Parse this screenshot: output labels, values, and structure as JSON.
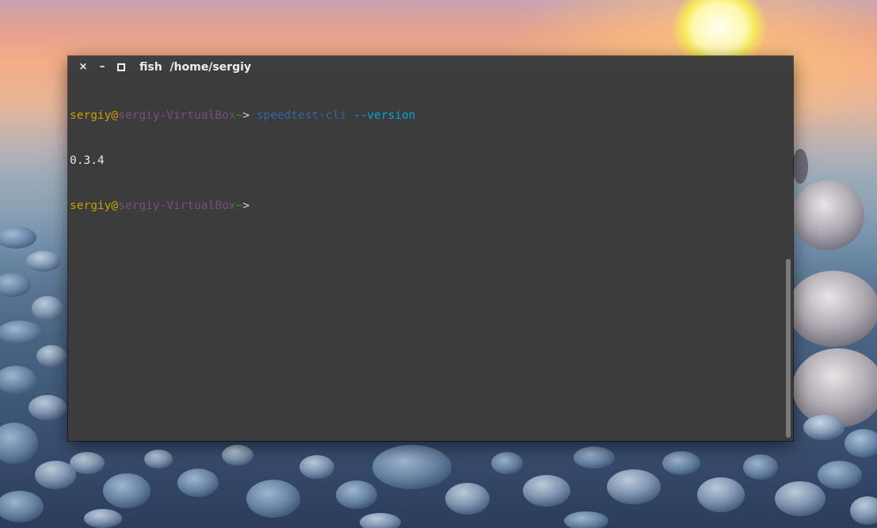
{
  "window": {
    "app": "fish",
    "path": "/home/sergiy",
    "buttons": {
      "close": "×",
      "minimize": "–"
    }
  },
  "terminal": {
    "lines": [
      {
        "user": "sergiy",
        "at": "@",
        "host": "sergiy-VirtualBox",
        "cwd": "~",
        "prompt": "> ",
        "command": "speedtest-cli",
        "args": " --version"
      },
      {
        "output": "0.3.4"
      },
      {
        "user": "sergiy",
        "at": "@",
        "host": "sergiy-VirtualBox",
        "cwd": "~",
        "prompt": ">"
      }
    ]
  },
  "colors": {
    "terminal_bg": "#3c3c3c",
    "user": "#c4a000",
    "host": "#75507b",
    "cwd": "#4e9a06",
    "command": "#3465a4",
    "argument": "#06a3d8"
  }
}
